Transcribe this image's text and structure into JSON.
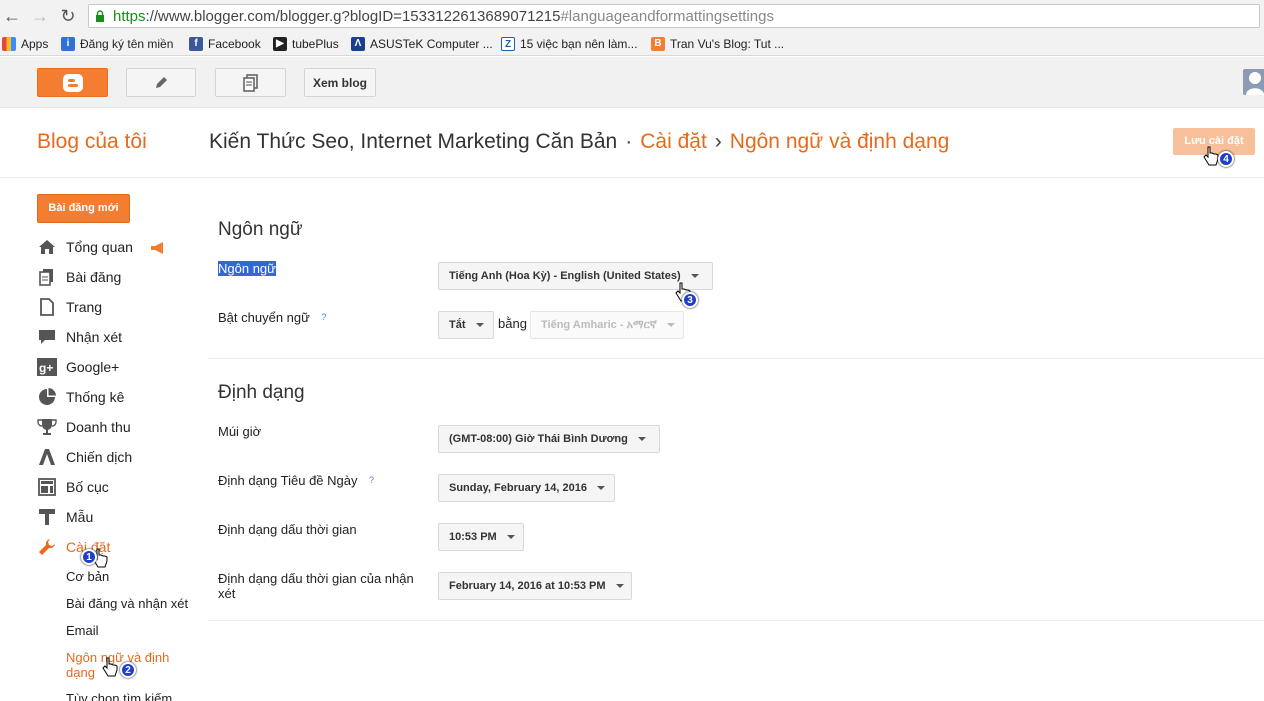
{
  "browser": {
    "url_scheme": "https",
    "url_main": "://www.blogger.com/blogger.g?blogID=1533122613689071215",
    "url_hash": "#languageandformattingsettings",
    "bookmarks": [
      {
        "label": "Apps",
        "icon": "apps-grid-icon",
        "color": "#e8453c"
      },
      {
        "label": "Đăng ký tên miền",
        "icon": "info-icon",
        "color": "#2e6fd8"
      },
      {
        "label": "Facebook",
        "icon": "facebook-icon",
        "color": "#3b5998"
      },
      {
        "label": "tubePlus",
        "icon": "tubeplus-icon",
        "color": "#222222"
      },
      {
        "label": "ASUSTeK Computer ...",
        "icon": "asus-icon",
        "color": "#1a3f8f"
      },
      {
        "label": "15 việc bạn nên làm...",
        "icon": "zing-icon",
        "color": "#1a5fa8"
      },
      {
        "label": "Tran Vu's Blog: Tut ...",
        "icon": "blogger-icon",
        "color": "#f57d31"
      }
    ]
  },
  "topbar": {
    "view_blog": "Xem blog"
  },
  "header": {
    "my_blog": "Blog của tôi",
    "blog_name": "Kiến Thức Seo, Internet Marketing Căn Bản",
    "sep1": "·",
    "settings": "Cài đặt",
    "sep2": "›",
    "page": "Ngôn ngữ và định dạng",
    "save": "Lưu cài đặt"
  },
  "sidebar": {
    "new_post": "Bài đăng mới",
    "items": [
      {
        "label": "Tổng quan",
        "icon": "home-icon"
      },
      {
        "label": "Bài đăng",
        "icon": "posts-icon"
      },
      {
        "label": "Trang",
        "icon": "page-icon"
      },
      {
        "label": "Nhận xét",
        "icon": "comment-icon"
      },
      {
        "label": "Google+",
        "icon": "google-plus-icon"
      },
      {
        "label": "Thống kê",
        "icon": "stats-icon"
      },
      {
        "label": "Doanh thu",
        "icon": "trophy-icon"
      },
      {
        "label": "Chiến dịch",
        "icon": "adwords-icon"
      },
      {
        "label": "Bố cục",
        "icon": "layout-icon"
      },
      {
        "label": "Mẫu",
        "icon": "template-icon"
      },
      {
        "label": "Cài đặt",
        "icon": "wrench-icon"
      }
    ],
    "sub_items": [
      "Cơ bản",
      "Bài đăng và nhận xét",
      "Email",
      "Ngôn ngữ và định dạng",
      "Tùy chọn tìm kiếm"
    ]
  },
  "language": {
    "title": "Ngôn ngữ",
    "lang_label": "Ngôn ngữ",
    "lang_value": "Tiếng Anh (Hoa Kỳ) - English (United States)",
    "translit_label": "Bật chuyển ngữ",
    "help": "?",
    "translit_value": "Tắt",
    "by_word": "bằng",
    "translit_lang": "Tiếng Amharic - አማርኛ"
  },
  "formatting": {
    "title": "Định dạng",
    "timezone_label": "Múi giờ",
    "timezone_value": "(GMT-08:00) Giờ Thái Bình Dương",
    "date_header_label": "Định dạng Tiêu đề Ngày",
    "date_header_value": "Sunday, February 14, 2016",
    "timestamp_label": "Định dạng dấu thời gian",
    "timestamp_value": "10:53 PM",
    "comment_ts_label": "Định dạng dấu thời gian của nhận xét",
    "comment_ts_value": "February 14, 2016 at 10:53 PM"
  },
  "steps": [
    "1",
    "2",
    "3",
    "4"
  ]
}
